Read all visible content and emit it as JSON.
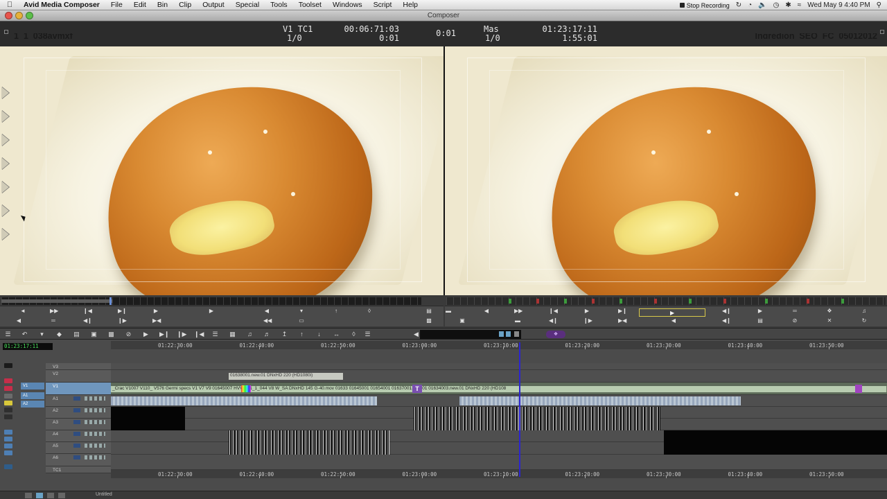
{
  "menubar": {
    "app": "Avid Media Composer",
    "items": [
      "File",
      "Edit",
      "Bin",
      "Clip",
      "Output",
      "Special",
      "Tools",
      "Toolset",
      "Windows",
      "Script",
      "Help"
    ],
    "recording": "Stop Recording",
    "clock": "Wed May 9  4:40 PM"
  },
  "window": {
    "title": "Composer"
  },
  "source": {
    "clip_name": "1_1_038avmxf",
    "track_label": "V1  TC1",
    "track_value": "1/0",
    "timecode": "00:06:71:03",
    "duration": "0:01"
  },
  "center": {
    "timecode": "0:01"
  },
  "record": {
    "clip_name": "Ingredion_SEQ_FC_05012012",
    "track_label": "Mas",
    "track_value": "1/0",
    "timecode": "01:23:17:11",
    "duration": "1:55:01"
  },
  "timeline": {
    "readout": "01:23:17:11",
    "ruler_labels": [
      "01:22:30:00",
      "01:22:40:00",
      "01:22:50:00",
      "01:23:00:00",
      "01:23:10:00",
      "01:23:20:00",
      "01:23:30:00",
      "01:23:40:00",
      "01:23:50:00"
    ],
    "tracks": [
      "V3",
      "V2",
      "V1",
      "A1",
      "A2",
      "A3",
      "A4",
      "A5",
      "A6",
      "TC1"
    ],
    "v2_clip": "01638001.new.01 DNxHD 220 (HD1080i)",
    "v1_text": "_Crac  V1007  V110_  V576 Germi  specs  V1  V7  V9  01645007  HVV_S  1_1_044  V8  W_SA  DNxHD 145  G-40.mov  01633  01645001  01654001  01637001.new.01  01634003.new.01 DNxHD 220 (HD108"
  },
  "status": {
    "bin": "Untitled"
  }
}
